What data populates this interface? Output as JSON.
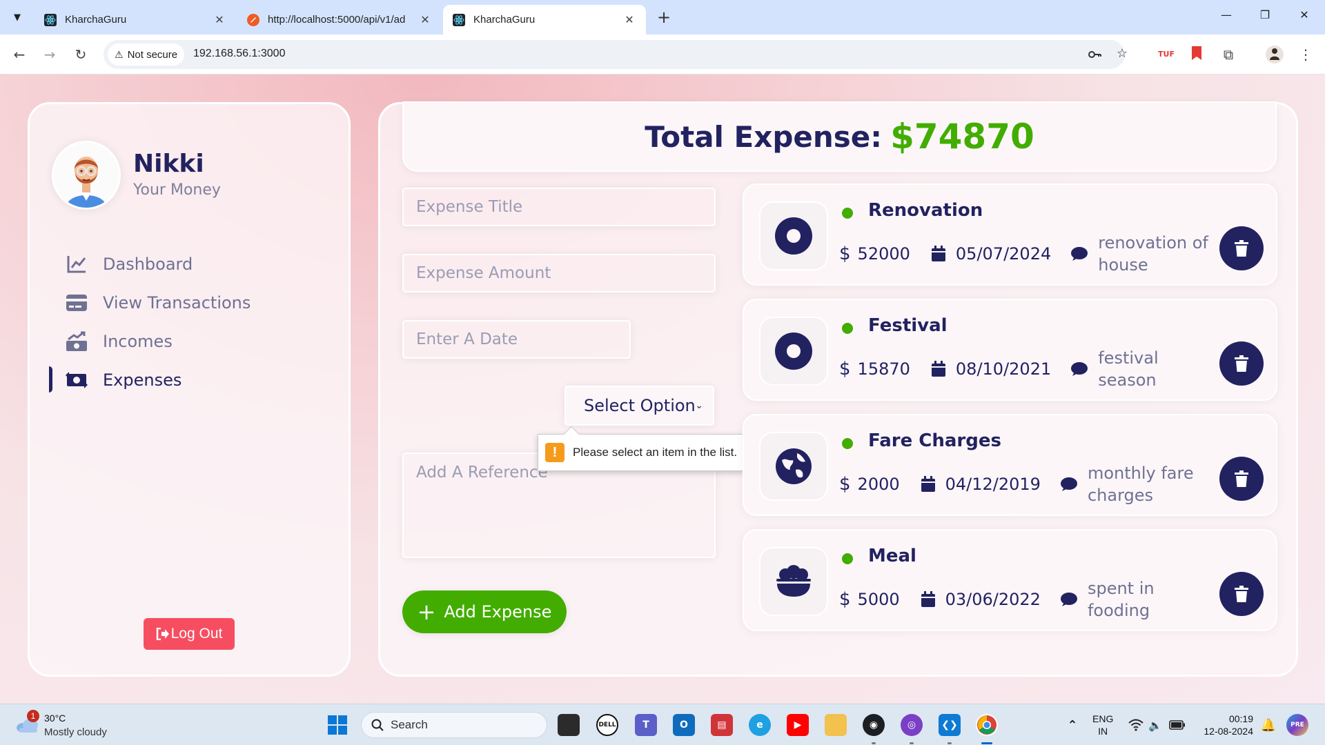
{
  "browser": {
    "tabs": [
      {
        "title": "KharchaGuru",
        "close": "✕"
      },
      {
        "title": "http://localhost:5000/api/v1/ad",
        "close": "✕"
      },
      {
        "title": "KharchaGuru",
        "close": "✕"
      }
    ],
    "new_tab": "+",
    "security_label": "Not secure",
    "url": "192.168.56.1:3000"
  },
  "sidebar": {
    "user_name": "Nikki",
    "user_subtitle": "Your Money",
    "menu": [
      {
        "label": "Dashboard",
        "icon": "chart-line-icon"
      },
      {
        "label": "View Transactions",
        "icon": "credit-card-icon"
      },
      {
        "label": "Incomes",
        "icon": "money-bill-trend-up-icon"
      },
      {
        "label": "Expenses",
        "icon": "money-bill-transfer-icon",
        "active": true
      }
    ],
    "logout_label": "Log Out"
  },
  "main": {
    "total_label": "Total Expense:",
    "total_amount": "$74870",
    "form": {
      "title_placeholder": "Expense Title",
      "amount_placeholder": "Expense Amount",
      "date_placeholder": "Enter A Date",
      "select_value": "Select Option",
      "reference_placeholder": "Add A Reference",
      "submit_label": "Add Expense",
      "validation_message": "Please select an item in the list."
    },
    "expenses": [
      {
        "title": "Renovation",
        "amount": "52000",
        "date": "05/07/2024",
        "description": "renovation of house",
        "icon": "circle-dot-icon"
      },
      {
        "title": "Festival",
        "amount": "15870",
        "date": "08/10/2021",
        "description": "festival season",
        "icon": "circle-dot-icon"
      },
      {
        "title": "Fare Charges",
        "amount": "2000",
        "date": "04/12/2019",
        "description": "monthly fare charges",
        "icon": "globe-icon"
      },
      {
        "title": "Meal",
        "amount": "5000",
        "date": "03/06/2022",
        "description": "spent in fooding",
        "icon": "bowl-food-icon"
      }
    ],
    "currency_symbol": "$"
  },
  "taskbar": {
    "weather_badge": "1",
    "temperature": "30°C",
    "condition": "Mostly cloudy",
    "search_label": "Search",
    "lang_top": "ENG",
    "lang_bottom": "IN",
    "time": "00:19",
    "date": "12-08-2024",
    "dell_label": "DELL"
  },
  "colors": {
    "brand_dark": "#222260",
    "accent_green": "#42ad00",
    "logout_red": "#f64e60"
  }
}
